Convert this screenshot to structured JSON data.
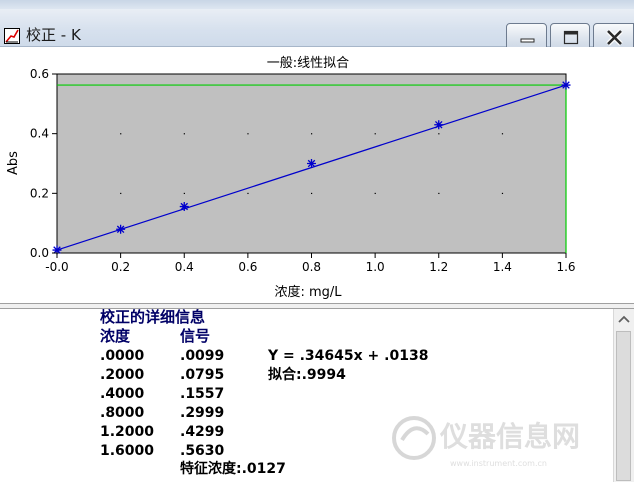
{
  "window": {
    "title": "校正 - K"
  },
  "titlebar_buttons": [
    "minimize",
    "maximize",
    "close"
  ],
  "chart_data": {
    "type": "scatter",
    "title": "一般:线性拟合",
    "xlabel": "浓度: mg/L",
    "ylabel": "Abs",
    "xlim": [
      0.0,
      1.6
    ],
    "ylim": [
      0.0,
      0.6
    ],
    "x_ticks": [
      "-0.0",
      "0.2",
      "0.4",
      "0.6",
      "0.8",
      "1.0",
      "1.2",
      "1.4",
      "1.6"
    ],
    "y_ticks": [
      "0.0",
      "0.2",
      "0.4",
      "0.6"
    ],
    "grid": "dotted",
    "plot_background": "#c0c0c0",
    "series": [
      {
        "values": [
          [
            0.0,
            0.0099
          ],
          [
            0.2,
            0.0795
          ],
          [
            0.4,
            0.1557
          ],
          [
            0.8,
            0.2999
          ],
          [
            1.2,
            0.4299
          ],
          [
            1.6,
            0.563
          ]
        ],
        "marker": "asterisk",
        "color": "#0000cc"
      }
    ],
    "fit_line": {
      "slope": 0.34645,
      "intercept": 0.0138,
      "color": "#0000cc"
    },
    "guide_lines": {
      "x": 1.6,
      "y": 0.563,
      "color": "#00cc00"
    }
  },
  "details": {
    "heading": "校正的详细信息",
    "col_conc": "浓度",
    "col_signal": "信号",
    "rows": [
      {
        "conc": ".0000",
        "signal": ".0099"
      },
      {
        "conc": ".2000",
        "signal": ".0795"
      },
      {
        "conc": ".4000",
        "signal": ".1557"
      },
      {
        "conc": ".8000",
        "signal": ".2999"
      },
      {
        "conc": "1.2000",
        "signal": ".4299"
      },
      {
        "conc": "1.6000",
        "signal": ".5630"
      }
    ],
    "equation": "Y = .34645x + .0138",
    "fit": "拟合:.9994",
    "char_conc": "特征浓度:.0127"
  },
  "watermark": {
    "text": "仪器信息网",
    "subtext": "www.instrument.com.cn"
  },
  "colors": {
    "axis_text": "#000000",
    "heading": "#000066",
    "fit_line": "#0000cc",
    "guide": "#00cc00"
  }
}
